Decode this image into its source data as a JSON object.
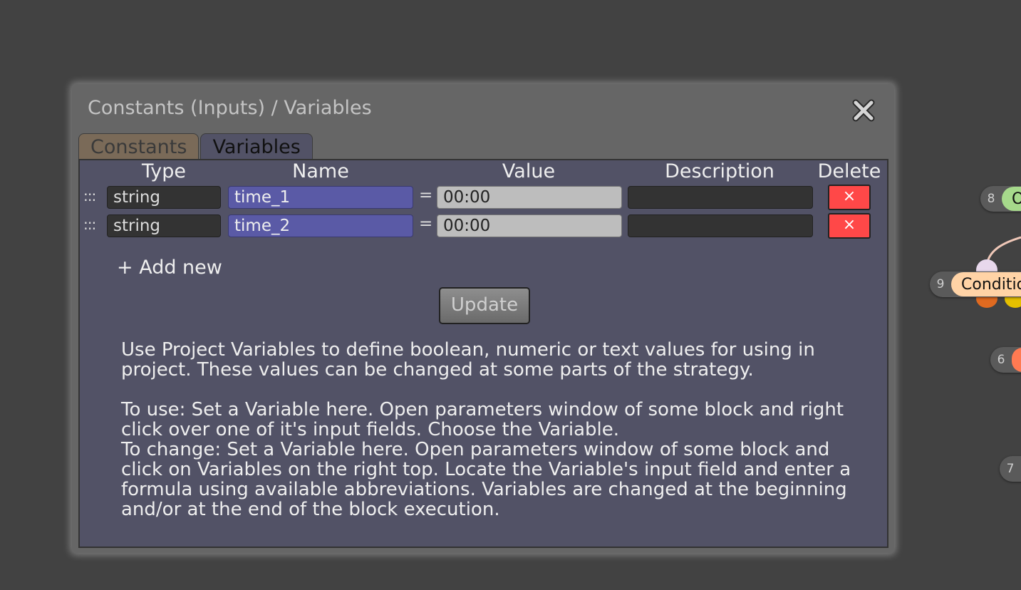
{
  "background_nodes": [
    {
      "num": "8",
      "label": "O"
    },
    {
      "num": "9",
      "label": "Conditio"
    },
    {
      "num": "6",
      "label": ""
    },
    {
      "num": "7",
      "label": ""
    }
  ],
  "dialog": {
    "title": "Constants (Inputs) / Variables",
    "close_icon": "close-icon",
    "tabs": [
      {
        "label": "Constants",
        "active": false
      },
      {
        "label": "Variables",
        "active": true
      }
    ],
    "table": {
      "headers": {
        "type": "Type",
        "name": "Name",
        "value": "Value",
        "description": "Description",
        "delete": "Delete"
      },
      "rows": [
        {
          "drag": ":::",
          "type": "string",
          "name": "time_1",
          "eq": "=",
          "value": "00:00",
          "description": "",
          "delete_symbol": "×"
        },
        {
          "drag": ":::",
          "type": "string",
          "name": "time_2",
          "eq": "=",
          "value": "00:00",
          "description": "",
          "delete_symbol": "×"
        }
      ]
    },
    "add_new_label": "+ Add new",
    "update_label": "Update",
    "help": {
      "p1": "Use Project Variables to define boolean, numeric or text values for using in project. These values can be changed at some parts of the strategy.",
      "p2": "To use: Set a Variable here. Open parameters window of some block and right click over one of it's input fields. Choose the Variable.",
      "p3": "To change: Set a Variable here. Open parameters window of some block and click on Variables on the right top. Locate the Variable's input field and enter a formula using available abbreviations. Variables are changed at the beginning and/or at the end of the block execution."
    }
  },
  "colors": {
    "background": "#424242",
    "dialog": "#666666",
    "panel": "#525266",
    "name_field": "#5a5aa6",
    "delete_button": "#ff4848",
    "node_green": "#a6d98b",
    "node_peach": "#ffd3a6",
    "node_orange": "#ff7a52"
  }
}
